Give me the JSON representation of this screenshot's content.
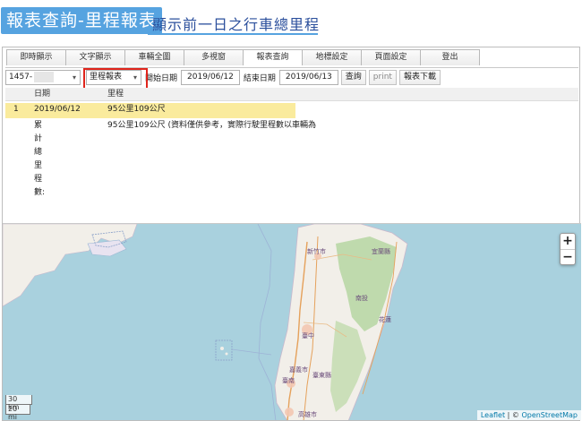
{
  "header": {
    "title": "報表查詢-里程報表",
    "subtitle": "顯示前一日之行車總里程"
  },
  "tabs": [
    {
      "label": "即時顯示"
    },
    {
      "label": "文字顯示"
    },
    {
      "label": "車輛全圖"
    },
    {
      "label": "多視窗"
    },
    {
      "label": "報表查詢",
      "active": true
    },
    {
      "label": "地標設定"
    },
    {
      "label": "頁面設定"
    },
    {
      "label": "登出"
    }
  ],
  "toolbar": {
    "vehicle_select": "1457-",
    "report_select": "里程報表",
    "start_label": "開始日期",
    "start_date": "2019/06/12",
    "end_label": "結束日期",
    "end_date": "2019/06/13",
    "query_button": "查詢",
    "print_button": "print",
    "download_button": "報表下載"
  },
  "table": {
    "headers": [
      "",
      "日期",
      "里程"
    ],
    "rows": [
      [
        "1",
        "2019/06/12",
        "95公里109公尺"
      ]
    ],
    "summary": {
      "label": "累計總里程數:",
      "value": "95公里109公尺 (資料僅供參考，實際行駛里程數以車輛為"
    }
  },
  "map": {
    "zoom_in": "+",
    "zoom_out": "−",
    "scale_km": "30 km",
    "scale_mi": "20 mi",
    "attribution_leaflet": "Leaflet",
    "attribution_sep": " | © ",
    "attribution_osm": "OpenStreetMap",
    "labels": {
      "hsinchu": "新竹市",
      "taichung": "臺中",
      "chiayi": "嘉義市",
      "tainan": "臺南",
      "kaohsiung": "高雄市",
      "nantou": "南投",
      "hualien": "花蓮",
      "taitung": "臺東縣",
      "yilan": "宜蘭縣"
    },
    "colors": {
      "sea": "#a9d1de",
      "land": "#f2efe9",
      "forest": "#b9d7a6",
      "road": "#e5a15b"
    }
  }
}
